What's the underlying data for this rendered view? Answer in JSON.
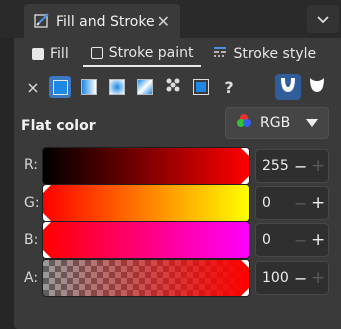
{
  "dock": {
    "tab_title": "Fill and Stroke",
    "close_glyph": "✕",
    "menu_glyph": "⌄"
  },
  "subtabs": [
    {
      "label": "Fill",
      "active": false
    },
    {
      "label": "Stroke paint",
      "active": true
    },
    {
      "label": "Stroke style",
      "active": false
    }
  ],
  "paint_types": [
    "no-paint",
    "flat-color",
    "linear-gradient",
    "radial-gradient",
    "mesh-gradient",
    "pattern",
    "swatch",
    "unset"
  ],
  "paint_unset_glyph": "?",
  "paint_none_glyph": "×",
  "selected_paint": "flat-color",
  "section_title": "Flat color",
  "color_mode": {
    "value": "RGB"
  },
  "channels": [
    {
      "label": "R:",
      "value": "255",
      "minus": "−",
      "plus": "+"
    },
    {
      "label": "G:",
      "value": "0",
      "minus": "−",
      "plus": "+"
    },
    {
      "label": "B:",
      "value": "0",
      "minus": "−",
      "plus": "+"
    },
    {
      "label": "A:",
      "value": "100",
      "minus": "−",
      "plus": "+"
    }
  ],
  "colors": {
    "accent": "#3b78c2",
    "current": "#ff0000"
  }
}
